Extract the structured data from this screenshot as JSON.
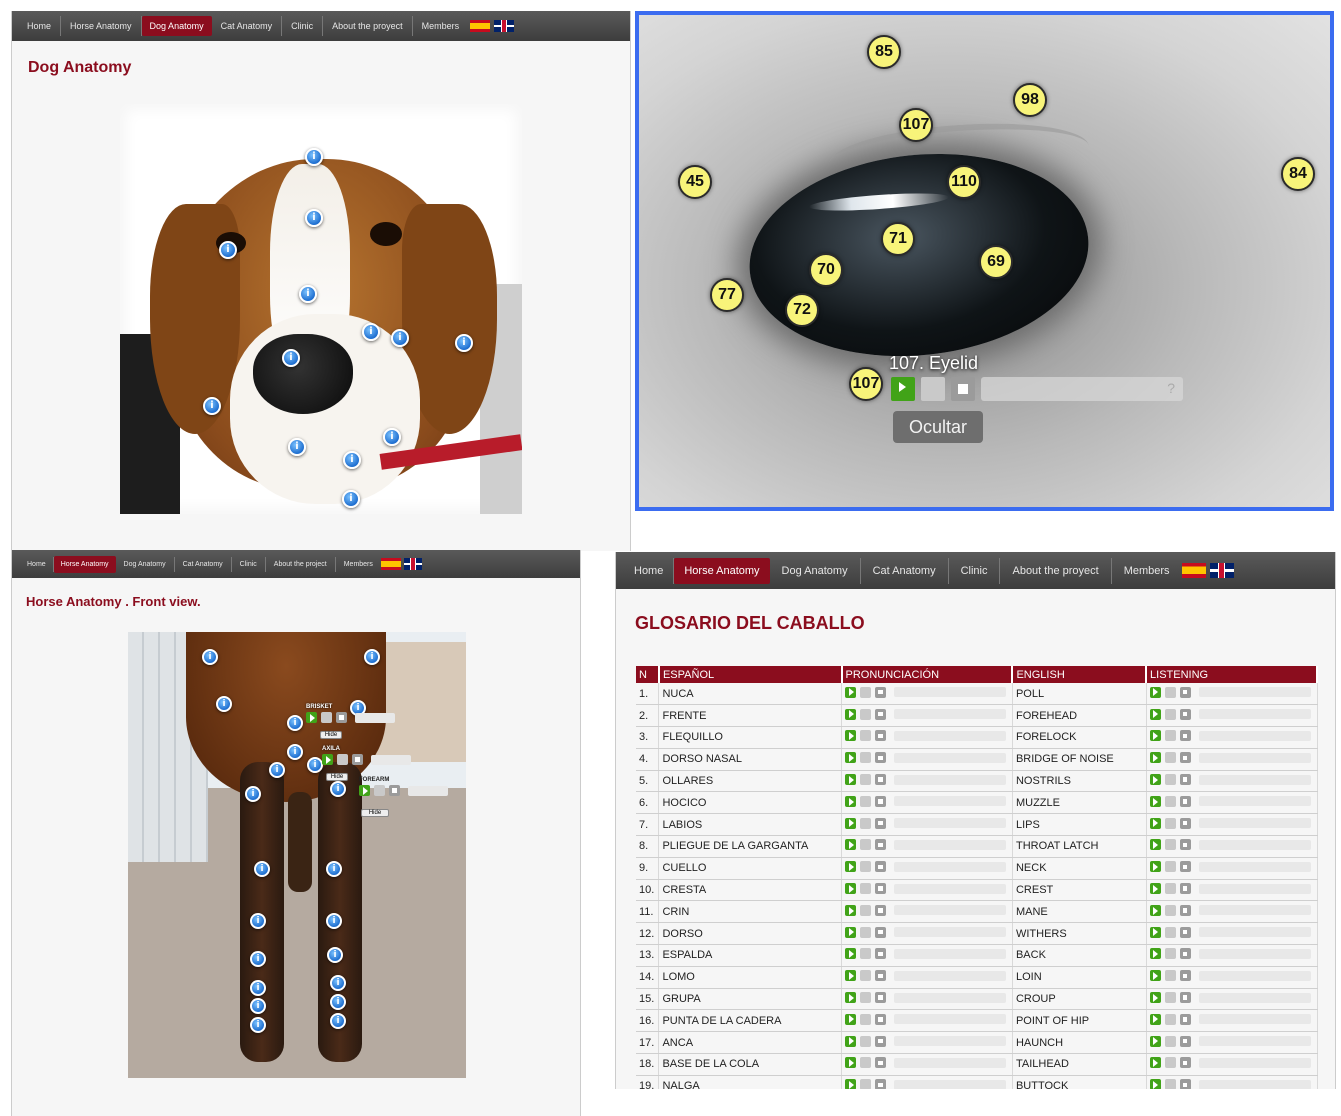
{
  "dog_page": {
    "nav": [
      "Home",
      "Horse Anatomy",
      "Dog Anatomy",
      "Cat Anatomy",
      "Clinic",
      "About the proyect",
      "Members"
    ],
    "active_index": 2,
    "title": "Dog Anatomy"
  },
  "eye_view": {
    "markers": [
      "85",
      "98",
      "107",
      "45",
      "110",
      "84",
      "71",
      "70",
      "69",
      "77",
      "72",
      "107"
    ],
    "caption": "107. Eyelid",
    "hide_button": "Ocultar",
    "info_mark": "?"
  },
  "horse_page": {
    "nav": [
      "Home",
      "Horse Anatomy",
      "Dog Anatomy",
      "Cat Anatomy",
      "Clinic",
      "About the project",
      "Members"
    ],
    "active_index": 1,
    "title": "Horse Anatomy . Front view.",
    "popups": [
      {
        "label": "BRISKET",
        "hide": "Hide"
      },
      {
        "label": "AXILA",
        "hide": "Hide"
      },
      {
        "label": "FOREARM",
        "hide": "Hide"
      }
    ]
  },
  "glossary_page": {
    "nav": [
      "Home",
      "Horse Anatomy",
      "Dog Anatomy",
      "Cat Anatomy",
      "Clinic",
      "About the proyect",
      "Members"
    ],
    "active_index": 1,
    "title": "GLOSARIO DEL CABALLO",
    "columns": [
      "N",
      "ESPAÑOL",
      "PRONUNCIACIÓN",
      "ENGLISH",
      "LISTENING"
    ],
    "rows": [
      {
        "n": "1.",
        "es": "NUCA",
        "en": "POLL"
      },
      {
        "n": "2.",
        "es": "FRENTE",
        "en": "FOREHEAD"
      },
      {
        "n": "3.",
        "es": "FLEQUILLO",
        "en": "FORELOCK"
      },
      {
        "n": "4.",
        "es": "DORSO NASAL",
        "en": "BRIDGE OF NOISE"
      },
      {
        "n": "5.",
        "es": "OLLARES",
        "en": "NOSTRILS"
      },
      {
        "n": "6.",
        "es": "HOCICO",
        "en": "MUZZLE"
      },
      {
        "n": "7.",
        "es": "LABIOS",
        "en": "LIPS"
      },
      {
        "n": "8.",
        "es": "PLIEGUE DE LA GARGANTA",
        "en": "THROAT LATCH"
      },
      {
        "n": "9.",
        "es": "CUELLO",
        "en": "NECK"
      },
      {
        "n": "10.",
        "es": "CRESTA",
        "en": "CREST"
      },
      {
        "n": "11.",
        "es": "CRIN",
        "en": "MANE"
      },
      {
        "n": "12.",
        "es": "DORSO",
        "en": "WITHERS"
      },
      {
        "n": "13.",
        "es": "ESPALDA",
        "en": "BACK"
      },
      {
        "n": "14.",
        "es": "LOMO",
        "en": "LOIN"
      },
      {
        "n": "15.",
        "es": "GRUPA",
        "en": "CROUP"
      },
      {
        "n": "16.",
        "es": "PUNTA DE LA CADERA",
        "en": "POINT OF HIP"
      },
      {
        "n": "17.",
        "es": "ANCA",
        "en": "HAUNCH"
      },
      {
        "n": "18.",
        "es": "BASE DE LA COLA",
        "en": "TAILHEAD"
      },
      {
        "n": "19.",
        "es": "NALGA",
        "en": "BUTTOCK"
      }
    ]
  },
  "hotspot_glyph": "i",
  "colors": {
    "accent": "#8b0d1e",
    "navbar": "#4a4a4a",
    "eye_frame": "#3b6cf0",
    "marker": "#f8f47a"
  }
}
